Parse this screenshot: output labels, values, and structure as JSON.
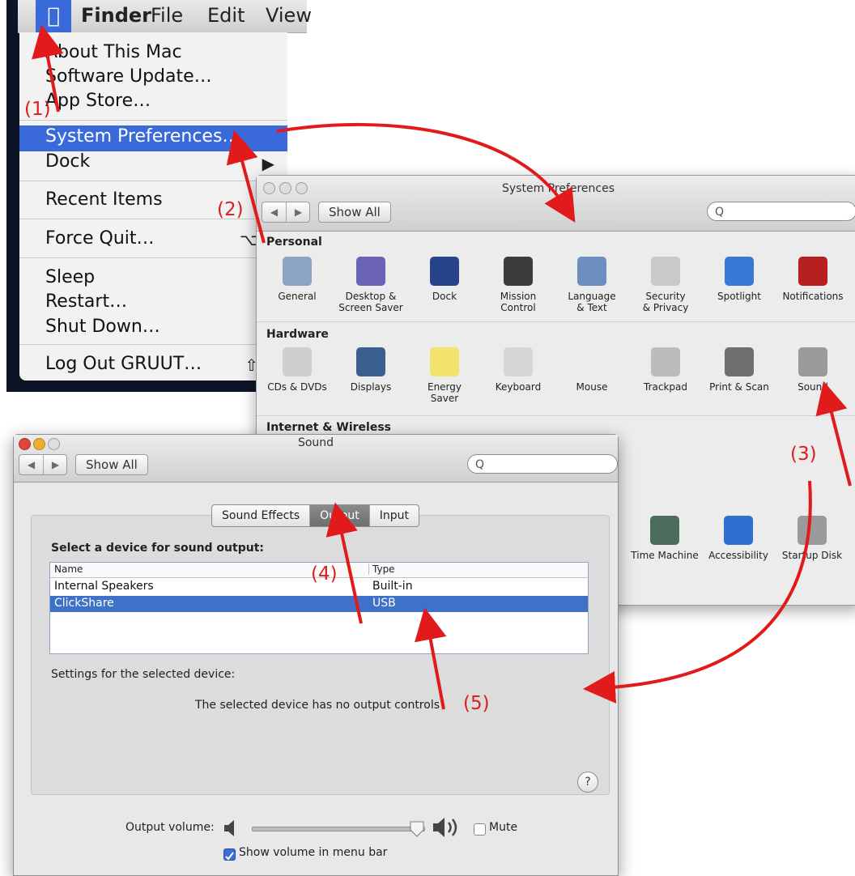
{
  "menubar": {
    "items": [
      "Finder",
      "File",
      "Edit",
      "View"
    ]
  },
  "apple_menu": {
    "items": [
      {
        "label": "About This Mac",
        "shortcut": ""
      },
      {
        "label": "Software Update…",
        "shortcut": ""
      },
      {
        "label": "App Store…",
        "shortcut": ""
      },
      {
        "label": "System Preferences…",
        "shortcut": ""
      },
      {
        "label": "Dock",
        "shortcut": "▶"
      },
      {
        "label": "Recent Items",
        "shortcut": ""
      },
      {
        "label": "Force Quit…",
        "shortcut": "⌥⌘"
      },
      {
        "label": "Sleep",
        "shortcut": ""
      },
      {
        "label": "Restart…",
        "shortcut": ""
      },
      {
        "label": "Shut Down…",
        "shortcut": ""
      },
      {
        "label": "Log Out GRUUT…",
        "shortcut": "⇧⌘"
      }
    ]
  },
  "syspref": {
    "title": "System Preferences",
    "show_all": "Show All",
    "search_glyph": "Q",
    "sections": {
      "personal": "Personal",
      "hardware": "Hardware",
      "internet": "Internet & Wireless"
    },
    "personal_panes": [
      {
        "line1": "General",
        "line2": "",
        "color": "#8da3c4"
      },
      {
        "line1": "Desktop &",
        "line2": "Screen Saver",
        "color": "#6a63b8"
      },
      {
        "line1": "Dock",
        "line2": "",
        "color": "#27448a"
      },
      {
        "line1": "Mission",
        "line2": "Control",
        "color": "#3c3c3c"
      },
      {
        "line1": "Language",
        "line2": "& Text",
        "color": "#6d8fc0"
      },
      {
        "line1": "Security",
        "line2": "& Privacy",
        "color": "#c9c9c9"
      },
      {
        "line1": "Spotlight",
        "line2": "",
        "color": "#3a78d6"
      },
      {
        "line1": "Notifications",
        "line2": "",
        "color": "#b82020"
      }
    ],
    "hardware_panes": [
      {
        "line1": "CDs & DVDs",
        "line2": "",
        "color": "#cfcfcf"
      },
      {
        "line1": "Displays",
        "line2": "",
        "color": "#3b5f8f"
      },
      {
        "line1": "Energy",
        "line2": "Saver",
        "color": "#f2e36a"
      },
      {
        "line1": "Keyboard",
        "line2": "",
        "color": "#d6d6d6"
      },
      {
        "line1": "Mouse",
        "line2": "",
        "color": "#ededed"
      },
      {
        "line1": "Trackpad",
        "line2": "",
        "color": "#bcbcbc"
      },
      {
        "line1": "Print & Scan",
        "line2": "",
        "color": "#6f6f6f"
      },
      {
        "line1": "Sound",
        "line2": "",
        "color": "#9a9a9a"
      }
    ],
    "system_panes": [
      {
        "line1": "Time Machine",
        "color": "#4d6d5c"
      },
      {
        "line1": "Accessibility",
        "color": "#2f6fd0"
      },
      {
        "line1": "Startup Disk",
        "color": "#9a9a9a"
      }
    ]
  },
  "sound": {
    "title": "Sound",
    "show_all": "Show All",
    "tabs": [
      "Sound Effects",
      "Output",
      "Input"
    ],
    "active_tab": "Output",
    "select_label": "Select a device for sound output:",
    "table": {
      "headers": [
        "Name",
        "Type"
      ],
      "rows": [
        {
          "name": "Internal Speakers",
          "type": "Built-in"
        },
        {
          "name": "ClickShare",
          "type": "USB"
        }
      ]
    },
    "settings_label": "Settings for the selected device:",
    "no_controls": "The selected device has no output controls",
    "help": "?",
    "volume_label": "Output volume:",
    "mute_label": "Mute",
    "show_volume_label": "Show volume in menu bar"
  },
  "annotations": [
    "(1)",
    "(2)",
    "(3)",
    "(4)",
    "(5)"
  ],
  "accent_color": "#d91e1e",
  "selection_color": "#3e71c7"
}
